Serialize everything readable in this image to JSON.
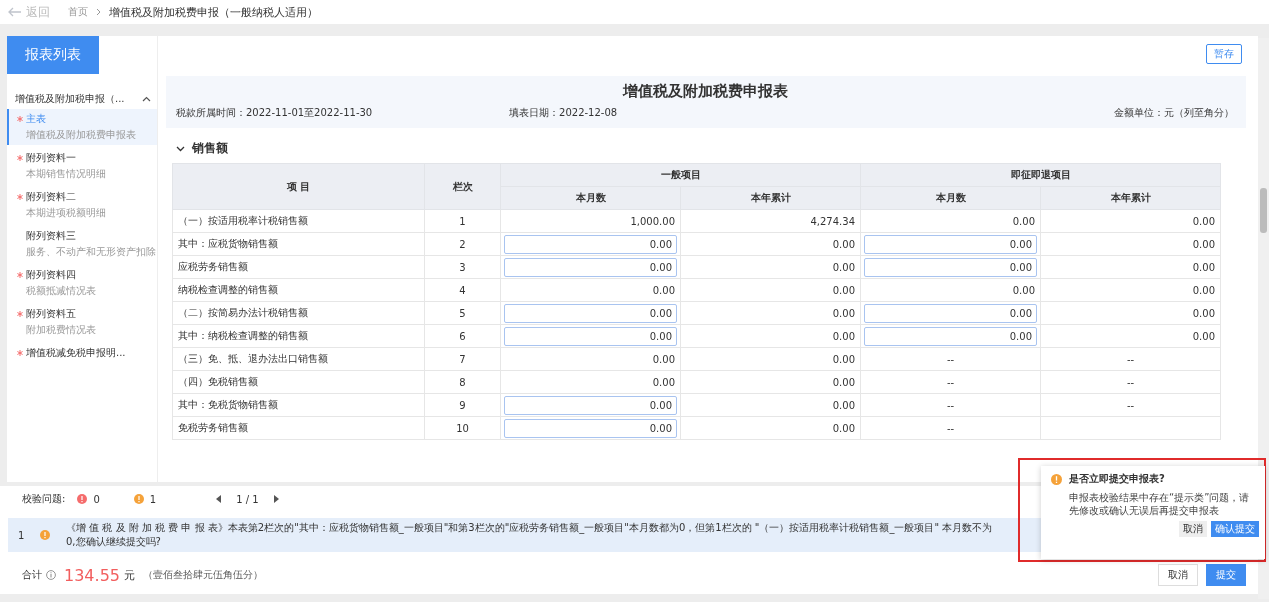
{
  "topbar": {
    "back": "返回",
    "breadcrumb": [
      "首页",
      "增值税及附加税费申报（一般纳税人适用）"
    ]
  },
  "sidebar": {
    "heading": "报表列表",
    "group": {
      "label": "增值税及附加税申报（...",
      "expanded": true,
      "items": [
        {
          "title": "主表",
          "subtitle": "增值税及附加税费申报表",
          "required": true,
          "selected": true
        },
        {
          "title": "附列资料一",
          "subtitle": "本期销售情况明细",
          "required": true,
          "selected": false
        },
        {
          "title": "附列资料二",
          "subtitle": "本期进项税额明细",
          "required": true,
          "selected": false
        },
        {
          "title": "附列资料三",
          "subtitle": "服务、不动产和无形资产扣除",
          "required": false,
          "selected": false
        },
        {
          "title": "附列资料四",
          "subtitle": "税额抵减情况表",
          "required": true,
          "selected": false
        },
        {
          "title": "附列资料五",
          "subtitle": "附加税费情况表",
          "required": true,
          "selected": false
        },
        {
          "title": "增值税减免税申报明...",
          "required": true,
          "selected": false
        }
      ]
    }
  },
  "save_button": "暂存",
  "form": {
    "title": "增值税及附加税费申报表",
    "period": "税款所属时间：2022-11-01至2022-11-30",
    "fill_date": "填表日期：2022-12-08",
    "unit": "金额单位：元（列至角分）"
  },
  "section": {
    "title": "销售额",
    "expanded": true
  },
  "table": {
    "col_item": "项 目",
    "col_line": "栏次",
    "groups": [
      "一般项目",
      "即征即退项目"
    ],
    "subcols": [
      "本月数",
      "本年累计",
      "本月数",
      "本年累计"
    ],
    "rows": [
      {
        "item": "（一）按适用税率计税销售额",
        "line": "1",
        "cells": [
          {
            "kind": "text",
            "value": "1,000.00"
          },
          {
            "kind": "text",
            "value": "4,274.34"
          },
          {
            "kind": "text",
            "value": "0.00"
          },
          {
            "kind": "text",
            "value": "0.00"
          }
        ]
      },
      {
        "item": "其中：应税货物销售额",
        "line": "2",
        "cells": [
          {
            "kind": "input",
            "value": "0.00"
          },
          {
            "kind": "text",
            "value": "0.00"
          },
          {
            "kind": "input",
            "value": "0.00"
          },
          {
            "kind": "text",
            "value": "0.00"
          }
        ]
      },
      {
        "item": "应税劳务销售额",
        "line": "3",
        "cells": [
          {
            "kind": "input",
            "value": "0.00"
          },
          {
            "kind": "text",
            "value": "0.00"
          },
          {
            "kind": "input",
            "value": "0.00"
          },
          {
            "kind": "text",
            "value": "0.00"
          }
        ]
      },
      {
        "item": "纳税检查调整的销售额",
        "line": "4",
        "cells": [
          {
            "kind": "text",
            "value": "0.00"
          },
          {
            "kind": "text",
            "value": "0.00"
          },
          {
            "kind": "text",
            "value": "0.00"
          },
          {
            "kind": "text",
            "value": "0.00"
          }
        ]
      },
      {
        "item": "（二）按简易办法计税销售额",
        "line": "5",
        "cells": [
          {
            "kind": "input",
            "value": "0.00"
          },
          {
            "kind": "text",
            "value": "0.00"
          },
          {
            "kind": "input",
            "value": "0.00"
          },
          {
            "kind": "text",
            "value": "0.00"
          }
        ]
      },
      {
        "item": "其中：纳税检查调整的销售额",
        "line": "6",
        "cells": [
          {
            "kind": "input",
            "value": "0.00"
          },
          {
            "kind": "text",
            "value": "0.00"
          },
          {
            "kind": "input",
            "value": "0.00"
          },
          {
            "kind": "text",
            "value": "0.00"
          }
        ]
      },
      {
        "item": "（三）免、抵、退办法出口销售额",
        "line": "7",
        "cells": [
          {
            "kind": "text",
            "value": "0.00"
          },
          {
            "kind": "text",
            "value": "0.00"
          },
          {
            "kind": "dash",
            "value": "--"
          },
          {
            "kind": "dash",
            "value": "--"
          }
        ]
      },
      {
        "item": "（四）免税销售额",
        "line": "8",
        "cells": [
          {
            "kind": "text",
            "value": "0.00"
          },
          {
            "kind": "text",
            "value": "0.00"
          },
          {
            "kind": "dash",
            "value": "--"
          },
          {
            "kind": "dash",
            "value": "--"
          }
        ]
      },
      {
        "item": "其中：免税货物销售额",
        "line": "9",
        "cells": [
          {
            "kind": "input",
            "value": "0.00"
          },
          {
            "kind": "text",
            "value": "0.00"
          },
          {
            "kind": "dash",
            "value": "--"
          },
          {
            "kind": "dash",
            "value": "--"
          }
        ]
      },
      {
        "item": "免税劳务销售额",
        "line": "10",
        "cells": [
          {
            "kind": "input",
            "value": "0.00"
          },
          {
            "kind": "text",
            "value": "0.00"
          },
          {
            "kind": "dash",
            "value": "--"
          },
          {
            "kind": "empty"
          }
        ]
      }
    ]
  },
  "validation": {
    "label": "校验问题:",
    "errors": "0",
    "warnings": "1",
    "page": "1 / 1"
  },
  "messages": [
    {
      "index": "1",
      "text": "《增 值 税 及 附 加 税 费 申 报 表》本表第2栏次的\"其中：应税货物销售额_一般项目\"和第3栏次的\"应税劳务销售额_一般项目\"本月数都为0，但第1栏次的 \"（一）按适用税率计税销售额_一般项目\" 本月数不为0,您确认继续提交吗?"
    }
  ],
  "total": {
    "label": "合计",
    "amount": "134.55",
    "currency": "元",
    "words": "（壹佰叁拾肆元伍角伍分）"
  },
  "footer_buttons": [
    "取消",
    "提交"
  ],
  "popup": {
    "title": "是否立即提交申报表?",
    "body": "申报表校验结果中存在“提示类”问题，请先修改或确认无误后再提交申报表",
    "buttons": [
      "取消",
      "确认提交"
    ]
  }
}
